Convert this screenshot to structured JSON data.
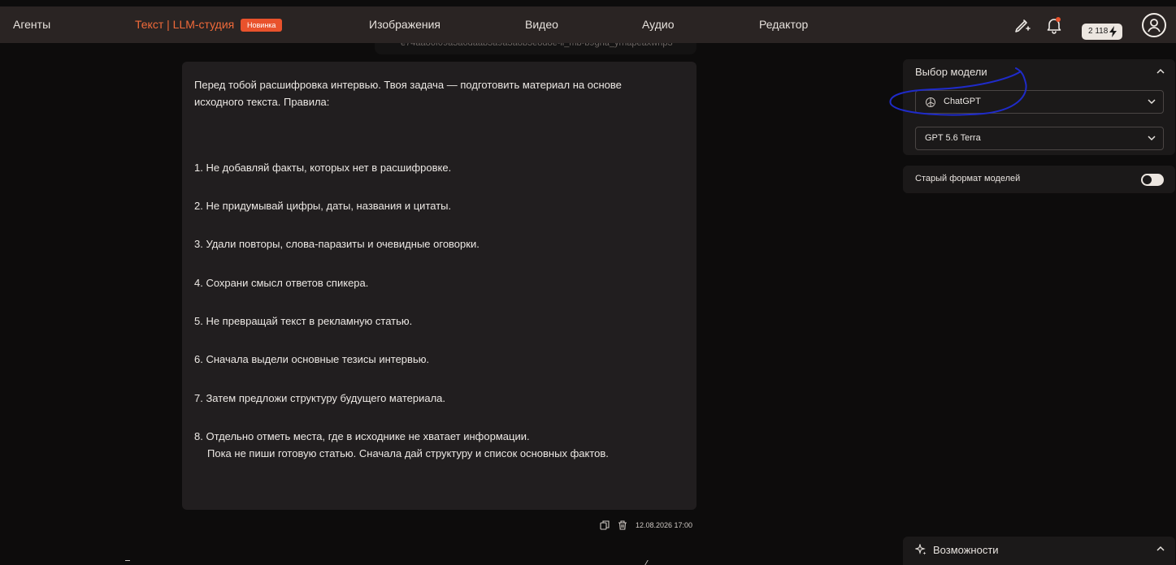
{
  "nav": {
    "agents": "Агенты",
    "text_studio": "Текст | LLM-студия",
    "new_badge": "Новинка",
    "images": "Изображения",
    "video": "Видео",
    "audio": "Аудио",
    "editor": "Редактор",
    "balance": "2 118",
    "accent_color": "#f06a3a"
  },
  "file_strip": {
    "text": "e74aa86f09a3a6daab3a9a3a8b3e8d8e-ii_mb-b9gha_yrnapeaxwnp3"
  },
  "message": {
    "intro": "Перед тобой расшифровка интервью. Твоя задача — подготовить материал на основе исходного текста. Правила:",
    "rules": [
      "1. Не добавляй факты, которых нет в расшифровке.",
      "2. Не придумывай цифры, даты, названия и цитаты.",
      "3. Удали повторы, слова-паразиты и очевидные оговорки.",
      "4. Сохрани смысл ответов спикера.",
      "5. Не превращай текст в рекламную статью.",
      "6. Сначала выдели основные тезисы интервью.",
      "7. Затем предложи структуру будущего материала.",
      "8. Отдельно отметь места, где в исходнике не хватает информации."
    ],
    "closing": "Пока не пиши готовую статью. Сначала дай структуру и список основных фактов.",
    "timestamp": "12.08.2026 17:00"
  },
  "model_panel": {
    "title": "Выбор модели",
    "provider": "ChatGPT",
    "model": "GPT 5.6 Terra",
    "old_format_label": "Старый формат моделей",
    "old_format_enabled": false
  },
  "features": {
    "title": "Возможности"
  }
}
